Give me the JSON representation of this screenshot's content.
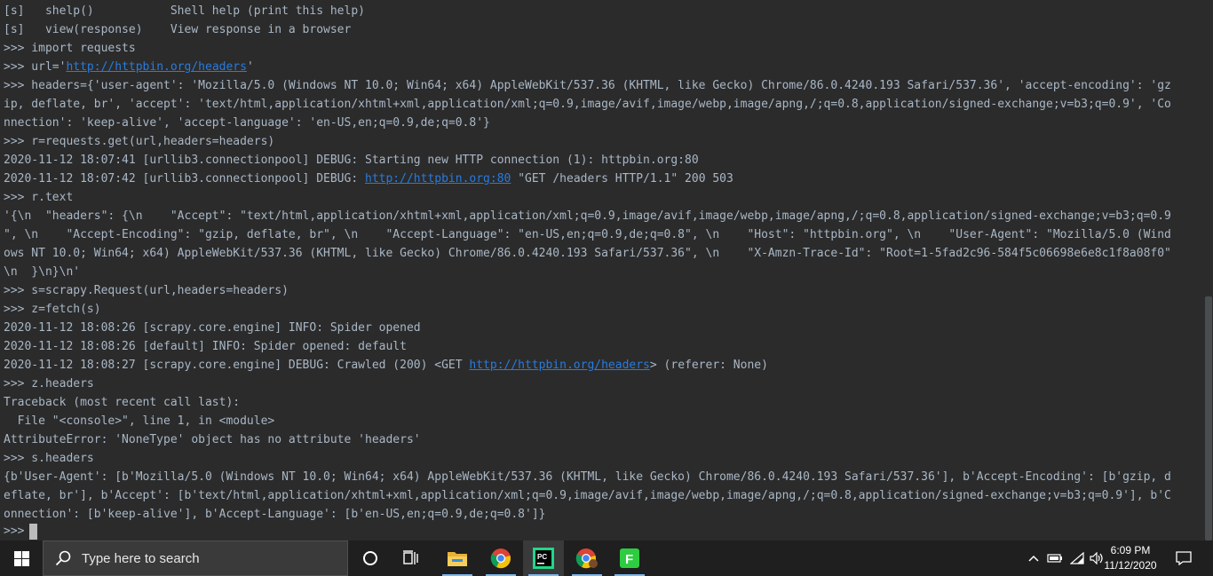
{
  "console": {
    "lines": [
      {
        "t": "[s]   shelp()           Shell help (print this help)"
      },
      {
        "t": "[s]   view(response)    View response in a browser"
      },
      {
        "t": ">>> import requests"
      },
      {
        "pre": ">>> url='",
        "link": "http://httpbin.org/headers",
        "post": "'"
      },
      {
        "t": ">>> headers={'user-agent': 'Mozilla/5.0 (Windows NT 10.0; Win64; x64) AppleWebKit/537.36 (KHTML, like Gecko) Chrome/86.0.4240.193 Safari/537.36', 'accept-encoding': 'gz"
      },
      {
        "t": "ip, deflate, br', 'accept': 'text/html,application/xhtml+xml,application/xml;q=0.9,image/avif,image/webp,image/apng,/;q=0.8,application/signed-exchange;v=b3;q=0.9', 'Co"
      },
      {
        "t": "nnection': 'keep-alive', 'accept-language': 'en-US,en;q=0.9,de;q=0.8'}"
      },
      {
        "t": ">>> r=requests.get(url,headers=headers)"
      },
      {
        "t": "2020-11-12 18:07:41 [urllib3.connectionpool] DEBUG: Starting new HTTP connection (1): httpbin.org:80"
      },
      {
        "pre": "2020-11-12 18:07:42 [urllib3.connectionpool] DEBUG: ",
        "link": "http://httpbin.org:80",
        "post": " \"GET /headers HTTP/1.1\" 200 503"
      },
      {
        "t": ">>> r.text"
      },
      {
        "t": "'{\\n  \"headers\": {\\n    \"Accept\": \"text/html,application/xhtml+xml,application/xml;q=0.9,image/avif,image/webp,image/apng,/;q=0.8,application/signed-exchange;v=b3;q=0.9"
      },
      {
        "t": "\", \\n    \"Accept-Encoding\": \"gzip, deflate, br\", \\n    \"Accept-Language\": \"en-US,en;q=0.9,de;q=0.8\", \\n    \"Host\": \"httpbin.org\", \\n    \"User-Agent\": \"Mozilla/5.0 (Wind"
      },
      {
        "t": "ows NT 10.0; Win64; x64) AppleWebKit/537.36 (KHTML, like Gecko) Chrome/86.0.4240.193 Safari/537.36\", \\n    \"X-Amzn-Trace-Id\": \"Root=1-5fad2c96-584f5c06698e6e8c1f8a08f0\""
      },
      {
        "t": "\\n  }\\n}\\n'"
      },
      {
        "t": ">>> s=scrapy.Request(url,headers=headers)"
      },
      {
        "t": ">>> z=fetch(s)"
      },
      {
        "t": "2020-11-12 18:08:26 [scrapy.core.engine] INFO: Spider opened"
      },
      {
        "t": "2020-11-12 18:08:26 [default] INFO: Spider opened: default"
      },
      {
        "pre": "2020-11-12 18:08:27 [scrapy.core.engine] DEBUG: Crawled (200) <GET ",
        "link": "http://httpbin.org/headers",
        "post": "> (referer: None)"
      },
      {
        "t": ">>> z.headers"
      },
      {
        "t": "Traceback (most recent call last):"
      },
      {
        "t": "  File \"<console>\", line 1, in <module>"
      },
      {
        "t": "AttributeError: 'NoneType' object has no attribute 'headers'"
      },
      {
        "t": ">>> s.headers"
      },
      {
        "t": "{b'User-Agent': [b'Mozilla/5.0 (Windows NT 10.0; Win64; x64) AppleWebKit/537.36 (KHTML, like Gecko) Chrome/86.0.4240.193 Safari/537.36'], b'Accept-Encoding': [b'gzip, d"
      },
      {
        "t": "eflate, br'], b'Accept': [b'text/html,application/xhtml+xml,application/xml;q=0.9,image/avif,image/webp,image/apng,/;q=0.8,application/signed-exchange;v=b3;q=0.9'], b'C"
      },
      {
        "t": "onnection': [b'keep-alive'], b'Accept-Language': [b'en-US,en;q=0.9,de;q=0.8']}"
      }
    ],
    "prompt": ">>>"
  },
  "taskbar": {
    "search_placeholder": "Type here to search",
    "time": "6:09 PM",
    "date": "11/12/2020",
    "apps": [
      "file-explorer",
      "chrome",
      "pycharm",
      "chrome-profile",
      "green-f-app"
    ]
  },
  "colors": {
    "console_bg": "#2b2b2b",
    "console_text": "#a9b7c6",
    "link": "#287bde",
    "taskbar_bg": "#1f1f1f"
  }
}
